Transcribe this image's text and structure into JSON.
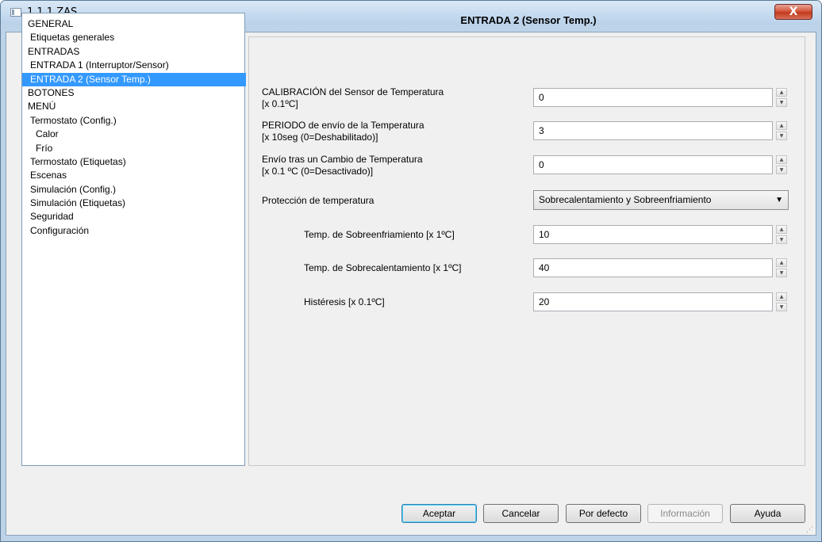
{
  "window": {
    "title": "1.1.1 ZAS",
    "close_glyph": "X"
  },
  "tree": {
    "items": [
      {
        "label": "GENERAL",
        "indent": 0,
        "selected": false
      },
      {
        "label": "Etiquetas generales",
        "indent": 1,
        "selected": false
      },
      {
        "label": "ENTRADAS",
        "indent": 0,
        "selected": false
      },
      {
        "label": "ENTRADA 1 (Interruptor/Sensor)",
        "indent": 1,
        "selected": false
      },
      {
        "label": "ENTRADA 2 (Sensor Temp.)",
        "indent": 1,
        "selected": true
      },
      {
        "label": "BOTONES",
        "indent": 0,
        "selected": false
      },
      {
        "label": "MENÚ",
        "indent": 0,
        "selected": false
      },
      {
        "label": "Termostato (Config.)",
        "indent": 1,
        "selected": false
      },
      {
        "label": "Calor",
        "indent": 2,
        "selected": false
      },
      {
        "label": "Frío",
        "indent": 2,
        "selected": false
      },
      {
        "label": "Termostato (Etiquetas)",
        "indent": 1,
        "selected": false
      },
      {
        "label": "Escenas",
        "indent": 1,
        "selected": false
      },
      {
        "label": "Simulación (Config.)",
        "indent": 1,
        "selected": false
      },
      {
        "label": "Simulación (Etiquetas)",
        "indent": 1,
        "selected": false
      },
      {
        "label": "Seguridad",
        "indent": 1,
        "selected": false
      },
      {
        "label": "Configuración",
        "indent": 1,
        "selected": false
      }
    ]
  },
  "panel": {
    "title": "ENTRADA 2 (Sensor Temp.)",
    "calibracion": {
      "label1": "CALIBRACIÓN del Sensor de Temperatura",
      "label2": "[x 0.1ºC]",
      "value": "0"
    },
    "periodo": {
      "label1": "PERIODO de envío de la Temperatura",
      "label2": "[x 10seg (0=Deshabilitado)]",
      "value": "3"
    },
    "envio": {
      "label1": "Envío tras un Cambio de Temperatura",
      "label2": "[x 0.1 ºC (0=Desactivado)]",
      "value": "0"
    },
    "proteccion": {
      "label": "Protección de temperatura",
      "value": "Sobrecalentamiento y Sobreenfriamiento"
    },
    "sobreenfriamiento": {
      "label": "Temp. de Sobreenfriamiento [x 1ºC]",
      "value": "10"
    },
    "sobrecalentamiento": {
      "label": "Temp. de Sobrecalentamiento [x 1ºC]",
      "value": "40"
    },
    "histeresis": {
      "label": "Histéresis [x 0.1ºC]",
      "value": "20"
    }
  },
  "buttons": {
    "aceptar": "Aceptar",
    "cancelar": "Cancelar",
    "por_defecto": "Por defecto",
    "informacion": "Información",
    "ayuda": "Ayuda"
  },
  "icons": {
    "spin_up": "▲",
    "spin_down": "▼",
    "dropdown": "▼",
    "grip": "⋰"
  },
  "colors": {
    "selection": "#3399ff",
    "window_frame": "#bcd3e8",
    "client_bg": "#f0f0f0"
  }
}
